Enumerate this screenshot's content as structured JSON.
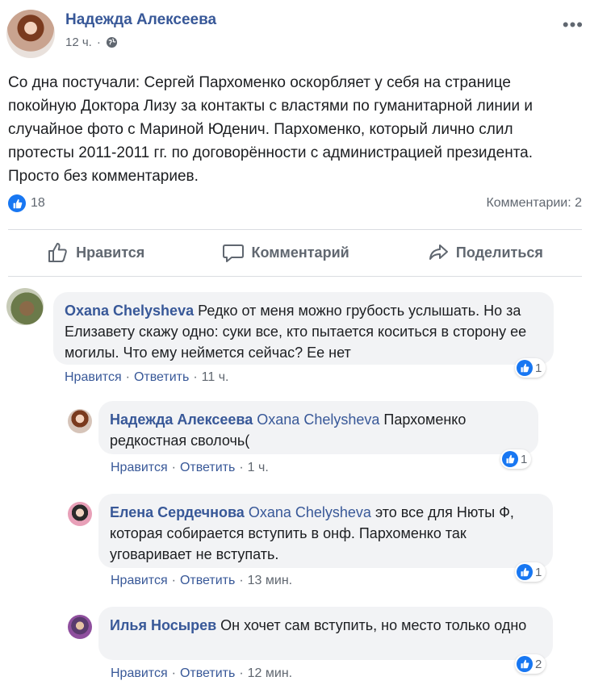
{
  "post": {
    "author": "Надежда Алексеева",
    "time": "12 ч.",
    "text": "Со дна постучали: Сергей Пархоменко оскорбляет у себя на странице покойную Доктора Лизу за контакты с властями по гуманитарной линии и случайное фото с Мариной Юденич. Пархоменко, который лично слил протесты 2011-2011 гг. по договорённости с администрацией президента. Просто без комментариев.",
    "like_count": "18",
    "comments_summary": "Комментарии: 2"
  },
  "actions": {
    "like": "Нравится",
    "comment": "Комментарий",
    "share": "Поделиться"
  },
  "comments": [
    {
      "author": "Oxana Chelysheva",
      "mention": "",
      "text": "Редко от меня можно грубость услышать. Но за Елизавету скажу одно: суки все, кто пытается коситься в сторону ее могилы. Что ему неймется сейчас? Ее нет",
      "like": "Нравится",
      "reply": "Ответить",
      "time": "11 ч.",
      "reactions": "1"
    },
    {
      "author": "Надежда Алексеева",
      "mention": "Oxana Chelysheva",
      "text": "Пархоменко редкостная сволочь(",
      "like": "Нравится",
      "reply": "Ответить",
      "time": "1 ч.",
      "reactions": "1"
    },
    {
      "author": "Елена Сердечнова",
      "mention": "Oxana Chelysheva",
      "text": "это все для Нюты Ф, которая собирается вступить в онф. Пархоменко так уговаривает не вступать.",
      "like": "Нравится",
      "reply": "Ответить",
      "time": "13 мин.",
      "reactions": "1"
    },
    {
      "author": "Илья Носырев",
      "mention": "",
      "text": "Он хочет сам вступить, но место только одно",
      "like": "Нравится",
      "reply": "Ответить",
      "time": "12 мин.",
      "reactions": "2"
    }
  ],
  "colors": {
    "link": "#385898",
    "like_blue": "#1877f2",
    "bubble": "#f2f3f5",
    "muted": "#606770"
  },
  "icons": [
    "globe-icon",
    "more-icon",
    "thumbs-up-icon",
    "comment-icon",
    "share-icon"
  ]
}
